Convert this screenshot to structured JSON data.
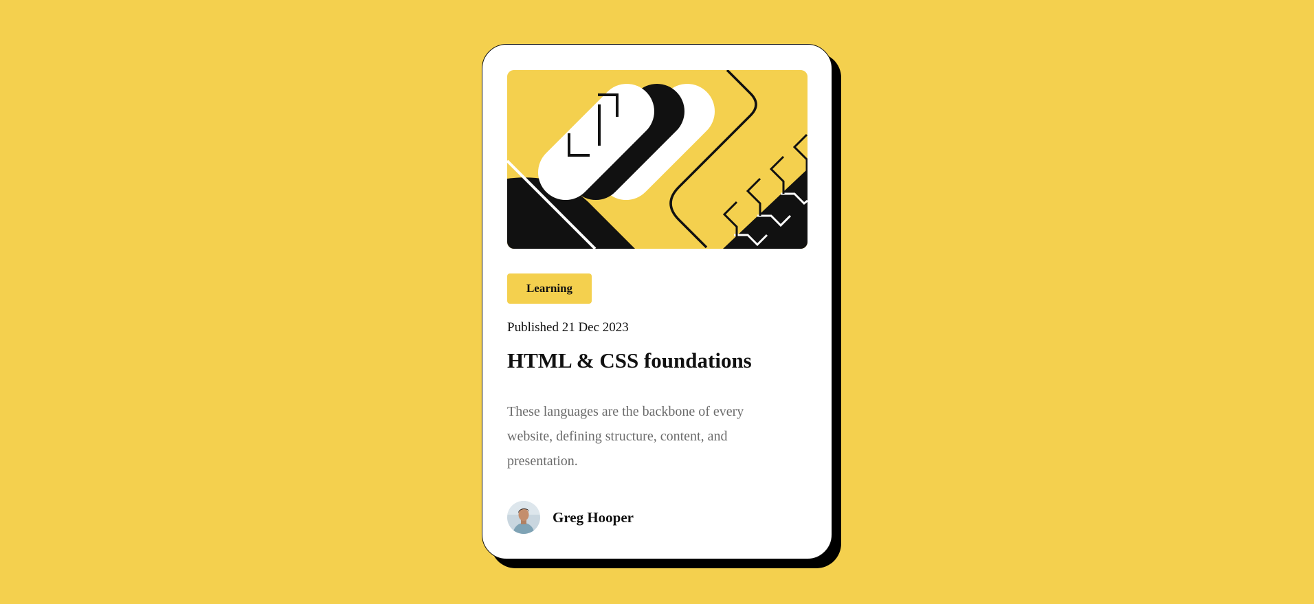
{
  "card": {
    "tag": "Learning",
    "published": "Published 21 Dec 2023",
    "title": "HTML & CSS foundations",
    "description": "These languages are the backbone of every website, defining structure, content, and presentation.",
    "author": {
      "name": "Greg Hooper"
    }
  },
  "colors": {
    "background": "#f4d04e",
    "card": "#ffffff",
    "text": "#111111",
    "muted": "#6b6b6b"
  }
}
